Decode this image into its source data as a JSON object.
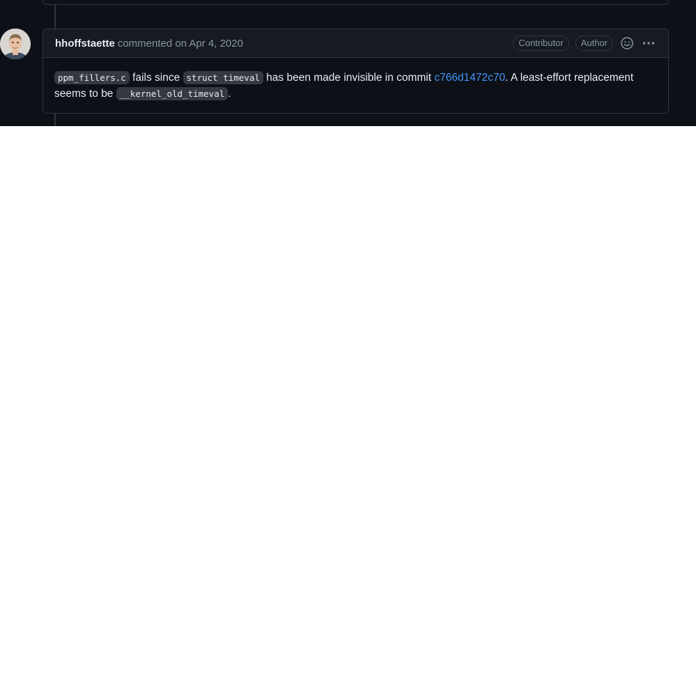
{
  "comment": {
    "author": "hhoffstaette",
    "action": "commented on Apr 4, 2020",
    "labels": {
      "contributor": "Contributor",
      "author": "Author"
    },
    "icons": {
      "reaction": "smiley-icon",
      "menu": "kebab-horizontal-icon"
    },
    "body": {
      "code_file": "ppm_fillers.c",
      "text_1": " fails since ",
      "code_struct": "struct timeval",
      "text_2": " has been made invisible in commit ",
      "commit_link": "c766d1472c70",
      "text_3": ". A least-effort replacement seems to be ",
      "code_replacement": "__kernel_old_timeval",
      "text_4": "."
    }
  },
  "colors": {
    "background": "#0d1117",
    "header_bg": "#161b22",
    "border": "#30363d",
    "link": "#4493f8",
    "muted": "#8b949e"
  }
}
